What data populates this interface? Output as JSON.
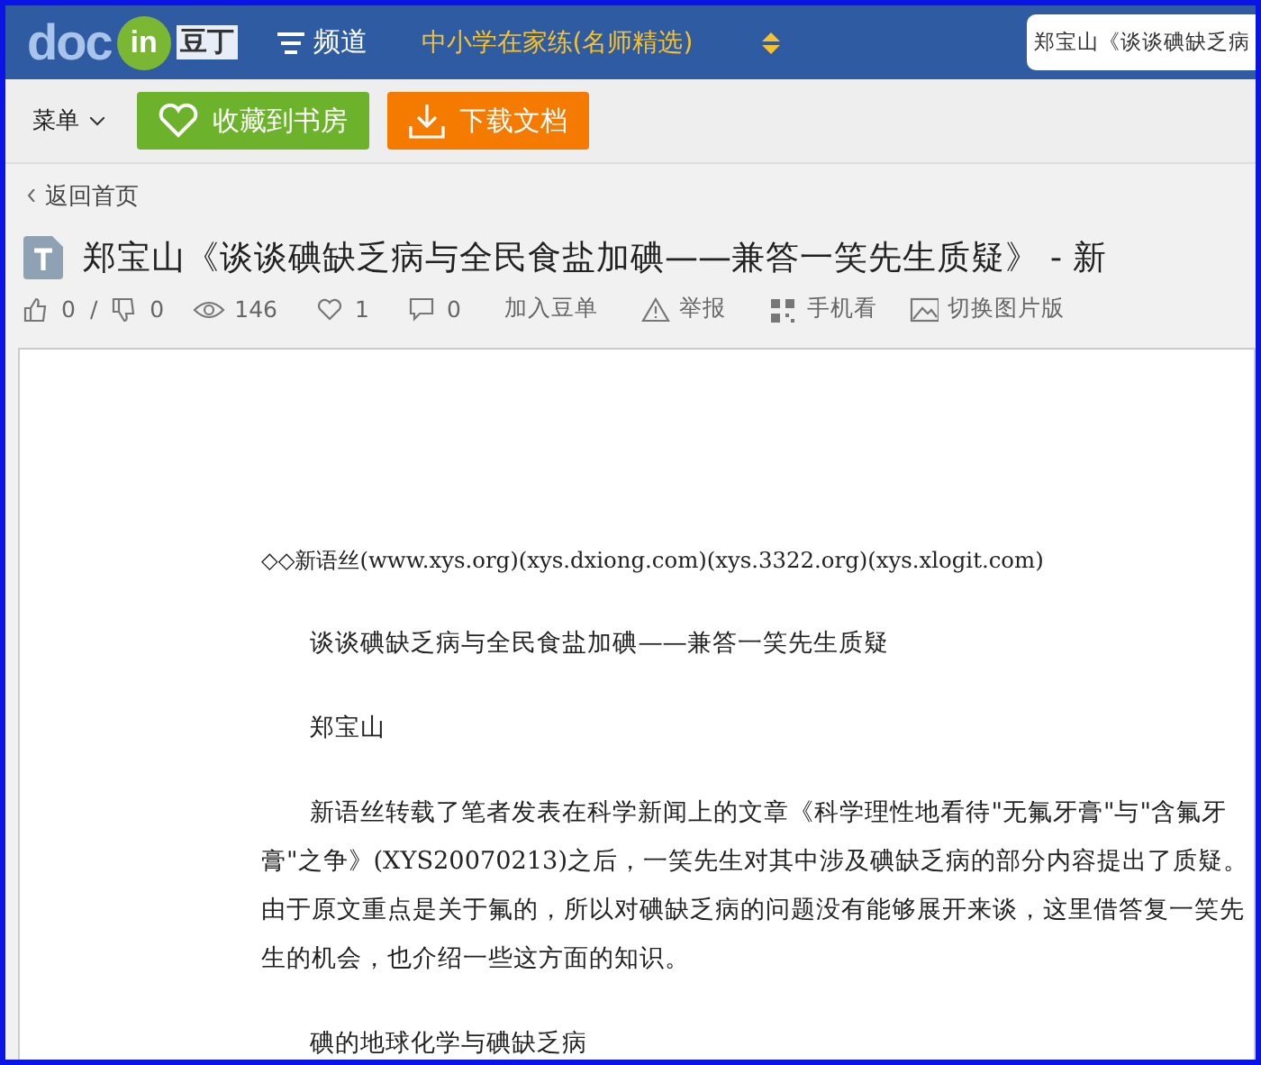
{
  "header": {
    "logo": {
      "word": "doc",
      "badge": "in",
      "cn": "豆丁"
    },
    "channel": "频道",
    "promo": "中小学在家练(名师精选)",
    "search_value": "郑宝山《谈谈碘缺乏病"
  },
  "toolbar": {
    "menu": "菜单",
    "buttons": [
      {
        "kind": "favorite",
        "label": "收藏到书房"
      },
      {
        "kind": "download",
        "label": "下载文档"
      }
    ]
  },
  "back_link": "返回首页",
  "title": "郑宝山《谈谈碘缺乏病与全民食盐加碘——兼答一笑先生质疑》 - 新",
  "stats": [
    {
      "kind": "like",
      "text": "0"
    },
    {
      "kind": "sep",
      "text": "/"
    },
    {
      "kind": "dislike",
      "text": "0"
    },
    {
      "kind": "views",
      "text": "146"
    },
    {
      "kind": "heart",
      "text": "1"
    },
    {
      "kind": "comment",
      "text": "0"
    },
    {
      "kind": "plain",
      "text": "加入豆单"
    },
    {
      "kind": "report",
      "text": "举报"
    },
    {
      "kind": "qr",
      "text": "手机看"
    },
    {
      "kind": "image",
      "text": "切换图片版"
    }
  ],
  "document": [
    {
      "kind": "source",
      "text": "◇◇新语丝(www.xys.org)(xys.dxiong.com)(xys.3322.org)(xys.xlogit.com)"
    },
    {
      "kind": "heading",
      "text": "谈谈碘缺乏病与全民食盐加碘——兼答一笑先生质疑"
    },
    {
      "kind": "heading",
      "text": "郑宝山"
    },
    {
      "kind": "paragraph",
      "text": "新语丝转载了笔者发表在科学新闻上的文章《科学理性地看待\"无氟牙膏\"与\"含氟牙膏\"之争》(XYS20070213)之后，一笑先生对其中涉及碘缺乏病的部分内容提出了质疑。由于原文重点是关于氟的，所以对碘缺乏病的问题没有能够展开来谈，这里借答复一笑先生的机会，也介绍一些这方面的知识。"
    },
    {
      "kind": "heading",
      "text": "碘的地球化学与碘缺乏病"
    }
  ]
}
